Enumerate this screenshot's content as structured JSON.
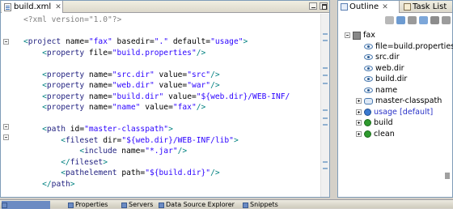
{
  "editor": {
    "tab_label": "build.xml",
    "close_glyph": "✕",
    "lines": [
      [
        {
          "c": "t-decl",
          "t": "<?xml version=\"1.0\"?>"
        }
      ],
      [],
      [
        {
          "c": "t-punct",
          "t": "<"
        },
        {
          "c": "t-tag",
          "t": "project"
        },
        {
          "c": "t-attr",
          "t": " name="
        },
        {
          "c": "t-val",
          "t": "\"fax\""
        },
        {
          "c": "t-attr",
          "t": " basedir="
        },
        {
          "c": "t-val",
          "t": "\".\""
        },
        {
          "c": "t-attr",
          "t": " default="
        },
        {
          "c": "t-val",
          "t": "\"usage\""
        },
        {
          "c": "t-punct",
          "t": ">"
        }
      ],
      [
        {
          "c": "t-attr",
          "t": "    "
        },
        {
          "c": "t-punct",
          "t": "<"
        },
        {
          "c": "t-tag",
          "t": "property"
        },
        {
          "c": "t-attr",
          "t": " file="
        },
        {
          "c": "t-val",
          "t": "\"build.properties\""
        },
        {
          "c": "t-punct",
          "t": "/>"
        }
      ],
      [],
      [
        {
          "c": "t-attr",
          "t": "    "
        },
        {
          "c": "t-punct",
          "t": "<"
        },
        {
          "c": "t-tag",
          "t": "property"
        },
        {
          "c": "t-attr",
          "t": " name="
        },
        {
          "c": "t-val",
          "t": "\"src.dir\""
        },
        {
          "c": "t-attr",
          "t": " value="
        },
        {
          "c": "t-val",
          "t": "\"src\""
        },
        {
          "c": "t-punct",
          "t": "/>"
        }
      ],
      [
        {
          "c": "t-attr",
          "t": "    "
        },
        {
          "c": "t-punct",
          "t": "<"
        },
        {
          "c": "t-tag",
          "t": "property"
        },
        {
          "c": "t-attr",
          "t": " name="
        },
        {
          "c": "t-val",
          "t": "\"web.dir\""
        },
        {
          "c": "t-attr",
          "t": " value="
        },
        {
          "c": "t-val",
          "t": "\"war\""
        },
        {
          "c": "t-punct",
          "t": "/>"
        }
      ],
      [
        {
          "c": "t-attr",
          "t": "    "
        },
        {
          "c": "t-punct",
          "t": "<"
        },
        {
          "c": "t-tag",
          "t": "property"
        },
        {
          "c": "t-attr",
          "t": " name="
        },
        {
          "c": "t-val",
          "t": "\"build.dir\""
        },
        {
          "c": "t-attr",
          "t": " value="
        },
        {
          "c": "t-val",
          "t": "\"${web.dir}/WEB-INF/"
        }
      ],
      [
        {
          "c": "t-attr",
          "t": "    "
        },
        {
          "c": "t-punct",
          "t": "<"
        },
        {
          "c": "t-tag",
          "t": "property"
        },
        {
          "c": "t-attr",
          "t": " name="
        },
        {
          "c": "t-val",
          "t": "\"name\""
        },
        {
          "c": "t-attr",
          "t": " value="
        },
        {
          "c": "t-val",
          "t": "\"fax\""
        },
        {
          "c": "t-punct",
          "t": "/>"
        }
      ],
      [],
      [
        {
          "c": "t-attr",
          "t": "    "
        },
        {
          "c": "t-punct",
          "t": "<"
        },
        {
          "c": "t-tag",
          "t": "path"
        },
        {
          "c": "t-attr",
          "t": " id="
        },
        {
          "c": "t-val",
          "t": "\"master-classpath\""
        },
        {
          "c": "t-punct",
          "t": ">"
        }
      ],
      [
        {
          "c": "t-attr",
          "t": "        "
        },
        {
          "c": "t-punct",
          "t": "<"
        },
        {
          "c": "t-tag",
          "t": "fileset"
        },
        {
          "c": "t-attr",
          "t": " dir="
        },
        {
          "c": "t-val",
          "t": "\"${web.dir}/WEB-INF/lib\""
        },
        {
          "c": "t-punct",
          "t": ">"
        }
      ],
      [
        {
          "c": "t-attr",
          "t": "            "
        },
        {
          "c": "t-punct",
          "t": "<"
        },
        {
          "c": "t-tag",
          "t": "include"
        },
        {
          "c": "t-attr",
          "t": " name="
        },
        {
          "c": "t-val",
          "t": "\"*.jar\""
        },
        {
          "c": "t-punct",
          "t": "/>"
        }
      ],
      [
        {
          "c": "t-attr",
          "t": "        "
        },
        {
          "c": "t-punct",
          "t": "</"
        },
        {
          "c": "t-tag",
          "t": "fileset"
        },
        {
          "c": "t-punct",
          "t": ">"
        }
      ],
      [
        {
          "c": "t-attr",
          "t": "        "
        },
        {
          "c": "t-punct",
          "t": "<"
        },
        {
          "c": "t-tag",
          "t": "pathelement"
        },
        {
          "c": "t-attr",
          "t": " path="
        },
        {
          "c": "t-val",
          "t": "\"${build.dir}\""
        },
        {
          "c": "t-punct",
          "t": "/>"
        }
      ],
      [
        {
          "c": "t-attr",
          "t": "    "
        },
        {
          "c": "t-punct",
          "t": "</"
        },
        {
          "c": "t-tag",
          "t": "path"
        },
        {
          "c": "t-punct",
          "t": ">"
        }
      ]
    ]
  },
  "outline": {
    "tab_label": "Outline",
    "close_glyph": "✕",
    "tasklist_label": "Task List",
    "tree": [
      {
        "label": "fax",
        "icon": "root-icon",
        "expander": "minus",
        "depth": 0
      },
      {
        "label": "file=build.properties",
        "icon": "property-icon",
        "depth": 1
      },
      {
        "label": "src.dir",
        "icon": "property-icon",
        "depth": 1
      },
      {
        "label": "web.dir",
        "icon": "property-icon",
        "depth": 1
      },
      {
        "label": "build.dir",
        "icon": "property-icon",
        "depth": 1
      },
      {
        "label": "name",
        "icon": "property-icon",
        "depth": 1
      },
      {
        "label": "master-classpath",
        "icon": "path-icon",
        "expander": "plus",
        "depth": 1
      },
      {
        "label": "usage [default]",
        "icon": "default-target-icon",
        "expander": "plus",
        "depth": 1,
        "highlight": true
      },
      {
        "label": "build",
        "icon": "target-icon",
        "expander": "plus",
        "depth": 1
      },
      {
        "label": "clean",
        "icon": "target-icon",
        "expander": "plus",
        "depth": 1
      }
    ]
  },
  "bottom_tabs": [
    {
      "label": "",
      "active": true
    },
    {
      "label": "Properties"
    },
    {
      "label": "Servers"
    },
    {
      "label": "Data Source Explorer"
    },
    {
      "label": "Snippets"
    }
  ],
  "colors": {
    "tag": "#1f1f7f",
    "value": "#2a00ff",
    "declaration": "#808080",
    "selection": "#2a33c8"
  }
}
